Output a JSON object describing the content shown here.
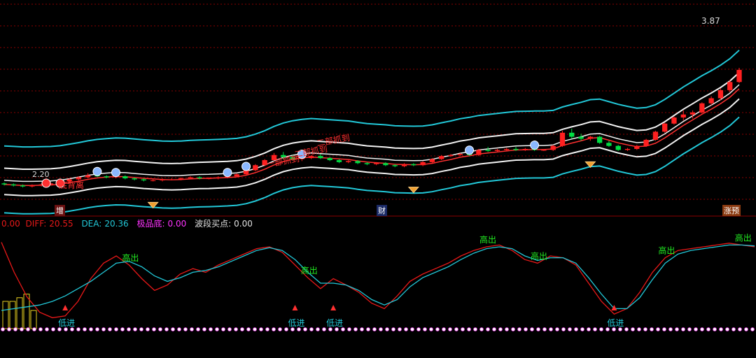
{
  "colors": {
    "background": "#000000",
    "grid": "#8b0000",
    "candle_up": "#ff2020",
    "candle_down": "#00dd44",
    "band_outer": "#22c8d8",
    "band_inner": "#f2f2f2",
    "ma": "#ff3030",
    "diff": "#e81818",
    "dea": "#22c8d8",
    "sell_text": "#22ee22",
    "buy_text": "#22c8d8",
    "dots": "#ff40ff",
    "magenta": "#ff33ff"
  },
  "header": {
    "zero": "0.00",
    "diff_label": "DIFF:",
    "diff_value": "20.55",
    "dea_label": "DEA:",
    "dea_value": "20.36",
    "jipin_label": "极品底:",
    "jipin_value": "0.00",
    "boduan_label": "波段买点:",
    "boduan_value": "0.00"
  },
  "price_labels": {
    "high": "3.87",
    "low": "2.20"
  },
  "bottom_tags": {
    "left": "增",
    "mid": "财",
    "right": "涨预"
  },
  "annotations": {
    "divergence": "底背离",
    "step1": "一部抓到",
    "step2": "二部抓到",
    "step3": "二部抓到",
    "sell": "高出",
    "buy": "低进"
  },
  "chart_data": {
    "type": "line",
    "title": "",
    "price_series": {
      "name": "price",
      "ohlc": [
        [
          2.26,
          2.27,
          2.24,
          2.25
        ],
        [
          2.25,
          2.26,
          2.23,
          2.24
        ],
        [
          2.24,
          2.25,
          2.22,
          2.23
        ],
        [
          2.23,
          2.25,
          2.22,
          2.24
        ],
        [
          2.24,
          2.26,
          2.23,
          2.25
        ],
        [
          2.25,
          2.27,
          2.24,
          2.26
        ],
        [
          2.26,
          2.29,
          2.25,
          2.28
        ],
        [
          2.28,
          2.31,
          2.27,
          2.3
        ],
        [
          2.3,
          2.33,
          2.29,
          2.32
        ],
        [
          2.32,
          2.36,
          2.31,
          2.34
        ],
        [
          2.34,
          2.35,
          2.32,
          2.33
        ],
        [
          2.33,
          2.34,
          2.31,
          2.32
        ],
        [
          2.32,
          2.34,
          2.31,
          2.33
        ],
        [
          2.33,
          2.34,
          2.3,
          2.31
        ],
        [
          2.31,
          2.32,
          2.29,
          2.3
        ],
        [
          2.3,
          2.31,
          2.28,
          2.29
        ],
        [
          2.29,
          2.3,
          2.28,
          2.29
        ],
        [
          2.29,
          2.31,
          2.28,
          2.3
        ],
        [
          2.3,
          2.31,
          2.29,
          2.3
        ],
        [
          2.3,
          2.32,
          2.29,
          2.31
        ],
        [
          2.31,
          2.33,
          2.3,
          2.32
        ],
        [
          2.32,
          2.33,
          2.3,
          2.31
        ],
        [
          2.31,
          2.32,
          2.3,
          2.31
        ],
        [
          2.31,
          2.33,
          2.3,
          2.32
        ],
        [
          2.32,
          2.34,
          2.31,
          2.33
        ],
        [
          2.33,
          2.36,
          2.32,
          2.35
        ],
        [
          2.35,
          2.4,
          2.34,
          2.39
        ],
        [
          2.39,
          2.45,
          2.38,
          2.44
        ],
        [
          2.44,
          2.5,
          2.43,
          2.49
        ],
        [
          2.49,
          2.56,
          2.48,
          2.54
        ],
        [
          2.54,
          2.57,
          2.5,
          2.52
        ],
        [
          2.52,
          2.54,
          2.49,
          2.5
        ],
        [
          2.5,
          2.52,
          2.48,
          2.51
        ],
        [
          2.51,
          2.54,
          2.5,
          2.53
        ],
        [
          2.53,
          2.55,
          2.5,
          2.51
        ],
        [
          2.51,
          2.52,
          2.48,
          2.49
        ],
        [
          2.49,
          2.5,
          2.46,
          2.47
        ],
        [
          2.47,
          2.49,
          2.46,
          2.48
        ],
        [
          2.48,
          2.49,
          2.45,
          2.46
        ],
        [
          2.46,
          2.47,
          2.44,
          2.45
        ],
        [
          2.45,
          2.47,
          2.44,
          2.46
        ],
        [
          2.46,
          2.47,
          2.43,
          2.44
        ],
        [
          2.44,
          2.45,
          2.42,
          2.43
        ],
        [
          2.43,
          2.46,
          2.42,
          2.45
        ],
        [
          2.45,
          2.46,
          2.43,
          2.44
        ],
        [
          2.44,
          2.48,
          2.43,
          2.47
        ],
        [
          2.47,
          2.51,
          2.46,
          2.5
        ],
        [
          2.5,
          2.54,
          2.49,
          2.53
        ],
        [
          2.53,
          2.55,
          2.52,
          2.54
        ],
        [
          2.54,
          2.56,
          2.53,
          2.55
        ],
        [
          2.55,
          2.56,
          2.53,
          2.54
        ],
        [
          2.54,
          2.6,
          2.53,
          2.59
        ],
        [
          2.59,
          2.62,
          2.57,
          2.58
        ],
        [
          2.58,
          2.6,
          2.57,
          2.59
        ],
        [
          2.59,
          2.61,
          2.58,
          2.6
        ],
        [
          2.6,
          2.62,
          2.58,
          2.59
        ],
        [
          2.59,
          2.61,
          2.58,
          2.6
        ],
        [
          2.6,
          2.61,
          2.58,
          2.59
        ],
        [
          2.59,
          2.6,
          2.58,
          2.59
        ],
        [
          2.59,
          2.64,
          2.58,
          2.63
        ],
        [
          2.63,
          2.78,
          2.62,
          2.76
        ],
        [
          2.76,
          2.8,
          2.7,
          2.72
        ],
        [
          2.72,
          2.75,
          2.68,
          2.7
        ],
        [
          2.7,
          2.73,
          2.68,
          2.72
        ],
        [
          2.72,
          2.73,
          2.65,
          2.66
        ],
        [
          2.66,
          2.68,
          2.62,
          2.63
        ],
        [
          2.63,
          2.64,
          2.58,
          2.59
        ],
        [
          2.59,
          2.61,
          2.58,
          2.6
        ],
        [
          2.6,
          2.64,
          2.59,
          2.63
        ],
        [
          2.63,
          2.7,
          2.62,
          2.69
        ],
        [
          2.69,
          2.78,
          2.68,
          2.77
        ],
        [
          2.77,
          2.86,
          2.76,
          2.85
        ],
        [
          2.85,
          2.92,
          2.84,
          2.91
        ],
        [
          2.91,
          2.98,
          2.88,
          2.94
        ],
        [
          2.94,
          2.98,
          2.9,
          2.96
        ],
        [
          2.96,
          3.06,
          2.95,
          3.05
        ],
        [
          3.05,
          3.12,
          3.03,
          3.1
        ],
        [
          3.1,
          3.2,
          3.08,
          3.18
        ],
        [
          3.18,
          3.28,
          3.16,
          3.26
        ],
        [
          3.26,
          3.4,
          3.25,
          3.38
        ]
      ]
    },
    "series": [
      {
        "name": "DIFF",
        "values": [
          0.95,
          0.62,
          0.35,
          0.18,
          0.12,
          0.14,
          0.3,
          0.55,
          0.72,
          0.8,
          0.7,
          0.55,
          0.42,
          0.48,
          0.6,
          0.66,
          0.62,
          0.7,
          0.76,
          0.82,
          0.88,
          0.9,
          0.84,
          0.7,
          0.56,
          0.44,
          0.55,
          0.48,
          0.4,
          0.28,
          0.22,
          0.36,
          0.52,
          0.6,
          0.66,
          0.72,
          0.8,
          0.86,
          0.9,
          0.92,
          0.86,
          0.76,
          0.72,
          0.8,
          0.78,
          0.7,
          0.5,
          0.3,
          0.16,
          0.22,
          0.4,
          0.62,
          0.78,
          0.86,
          0.88,
          0.9,
          0.92,
          0.94,
          0.92,
          0.9
        ]
      },
      {
        "name": "DEA",
        "values": [
          0.2,
          0.22,
          0.24,
          0.26,
          0.3,
          0.36,
          0.44,
          0.52,
          0.62,
          0.72,
          0.74,
          0.68,
          0.58,
          0.52,
          0.56,
          0.62,
          0.64,
          0.68,
          0.74,
          0.8,
          0.86,
          0.89,
          0.86,
          0.76,
          0.62,
          0.5,
          0.5,
          0.48,
          0.42,
          0.32,
          0.26,
          0.32,
          0.46,
          0.56,
          0.62,
          0.68,
          0.76,
          0.83,
          0.88,
          0.9,
          0.88,
          0.8,
          0.75,
          0.78,
          0.78,
          0.72,
          0.56,
          0.38,
          0.22,
          0.22,
          0.34,
          0.54,
          0.72,
          0.82,
          0.86,
          0.88,
          0.9,
          0.92,
          0.92,
          0.91
        ]
      }
    ],
    "signals": {
      "sell_indices": [
        10,
        24,
        38,
        42,
        52,
        58
      ],
      "buy_indices": [
        5,
        23,
        26,
        48
      ]
    },
    "ylim": [
      2.0,
      4.0
    ],
    "grid": true
  }
}
